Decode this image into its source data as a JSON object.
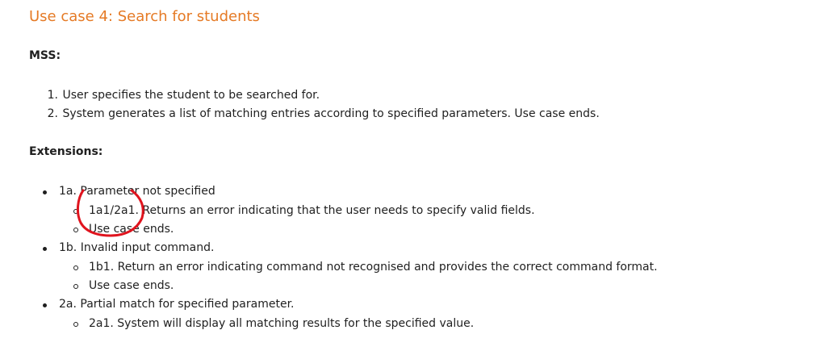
{
  "title": "Use case 4: Search for students",
  "mss": {
    "heading": "MSS:",
    "steps": [
      {
        "num": "1.",
        "text": "User specifies the student to be searched for."
      },
      {
        "num": "2.",
        "text": "System generates a list of matching entries according to specified parameters. Use case ends."
      }
    ]
  },
  "extensions": {
    "heading": "Extensions:",
    "items": [
      {
        "text": "1a. Parameter not specified",
        "subs": [
          "1a1/2a1. Returns an error indicating that the user needs to specify valid fields.",
          "Use case ends."
        ]
      },
      {
        "text": "1b. Invalid input command.",
        "subs": [
          "1b1. Return an error indicating command not recognised and provides the correct command format.",
          "Use case ends."
        ]
      },
      {
        "text": "2a. Partial match for specified parameter.",
        "subs": [
          "2a1. System will display all matching results for the specified value."
        ]
      }
    ]
  },
  "colors": {
    "title": "#e57a25",
    "text": "#1f1f1f",
    "annotation": "#e0141e"
  }
}
